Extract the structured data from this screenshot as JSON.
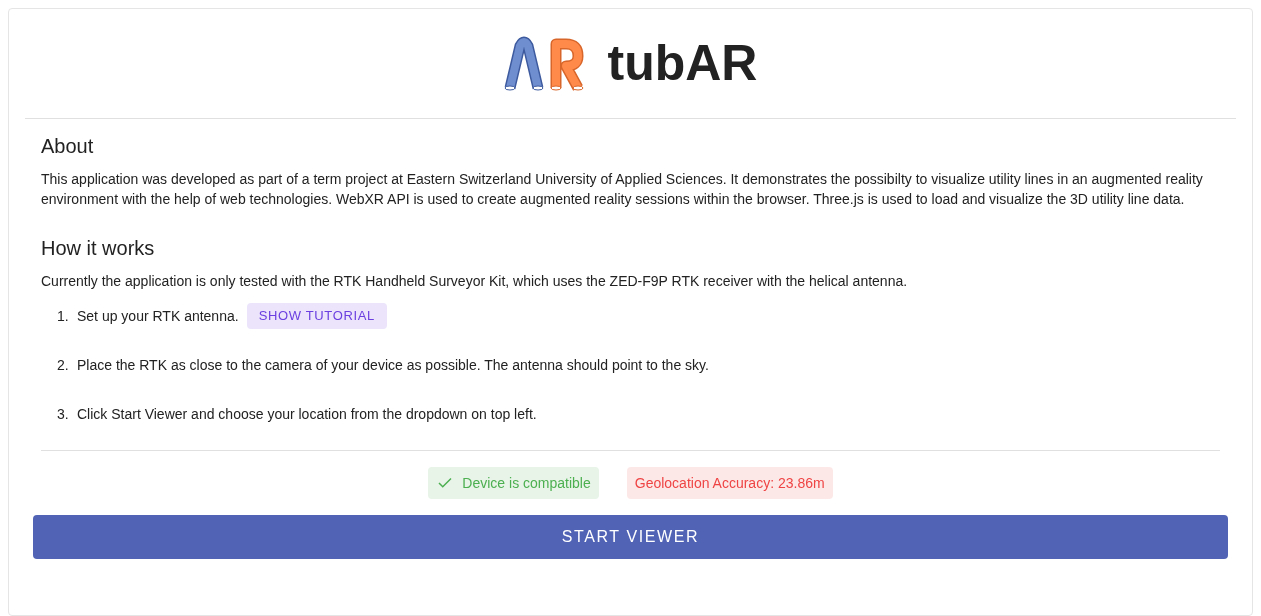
{
  "header": {
    "title": "tubAR"
  },
  "about": {
    "heading": "About",
    "text": "This application was developed as part of a term project at Eastern Switzerland University of Applied Sciences. It demonstrates the possibilty to visualize utility lines in an augmented reality environment with the help of web technologies. WebXR API is used to create augmented reality sessions within the browser. Three.js is used to load and visualize the 3D utility line data."
  },
  "how_it_works": {
    "heading": "How it works",
    "intro": "Currently the application is only tested with the RTK Handheld Surveyor Kit, which uses the ZED-F9P RTK receiver with the helical antenna.",
    "steps": [
      {
        "number": "1.",
        "text": "Set up your RTK antenna.",
        "button": "SHOW TUTORIAL"
      },
      {
        "number": "2.",
        "text": "Place the RTK as close to the camera of your device as possible. The antenna should point to the sky."
      },
      {
        "number": "3.",
        "text": "Click Start Viewer and choose your location from the dropdown on top left."
      }
    ]
  },
  "status": [
    {
      "kind": "success",
      "text": "Device is compatible"
    },
    {
      "kind": "error",
      "text": "Geolocation Accuracy: 23.86m"
    }
  ],
  "start_button": "START VIEWER"
}
